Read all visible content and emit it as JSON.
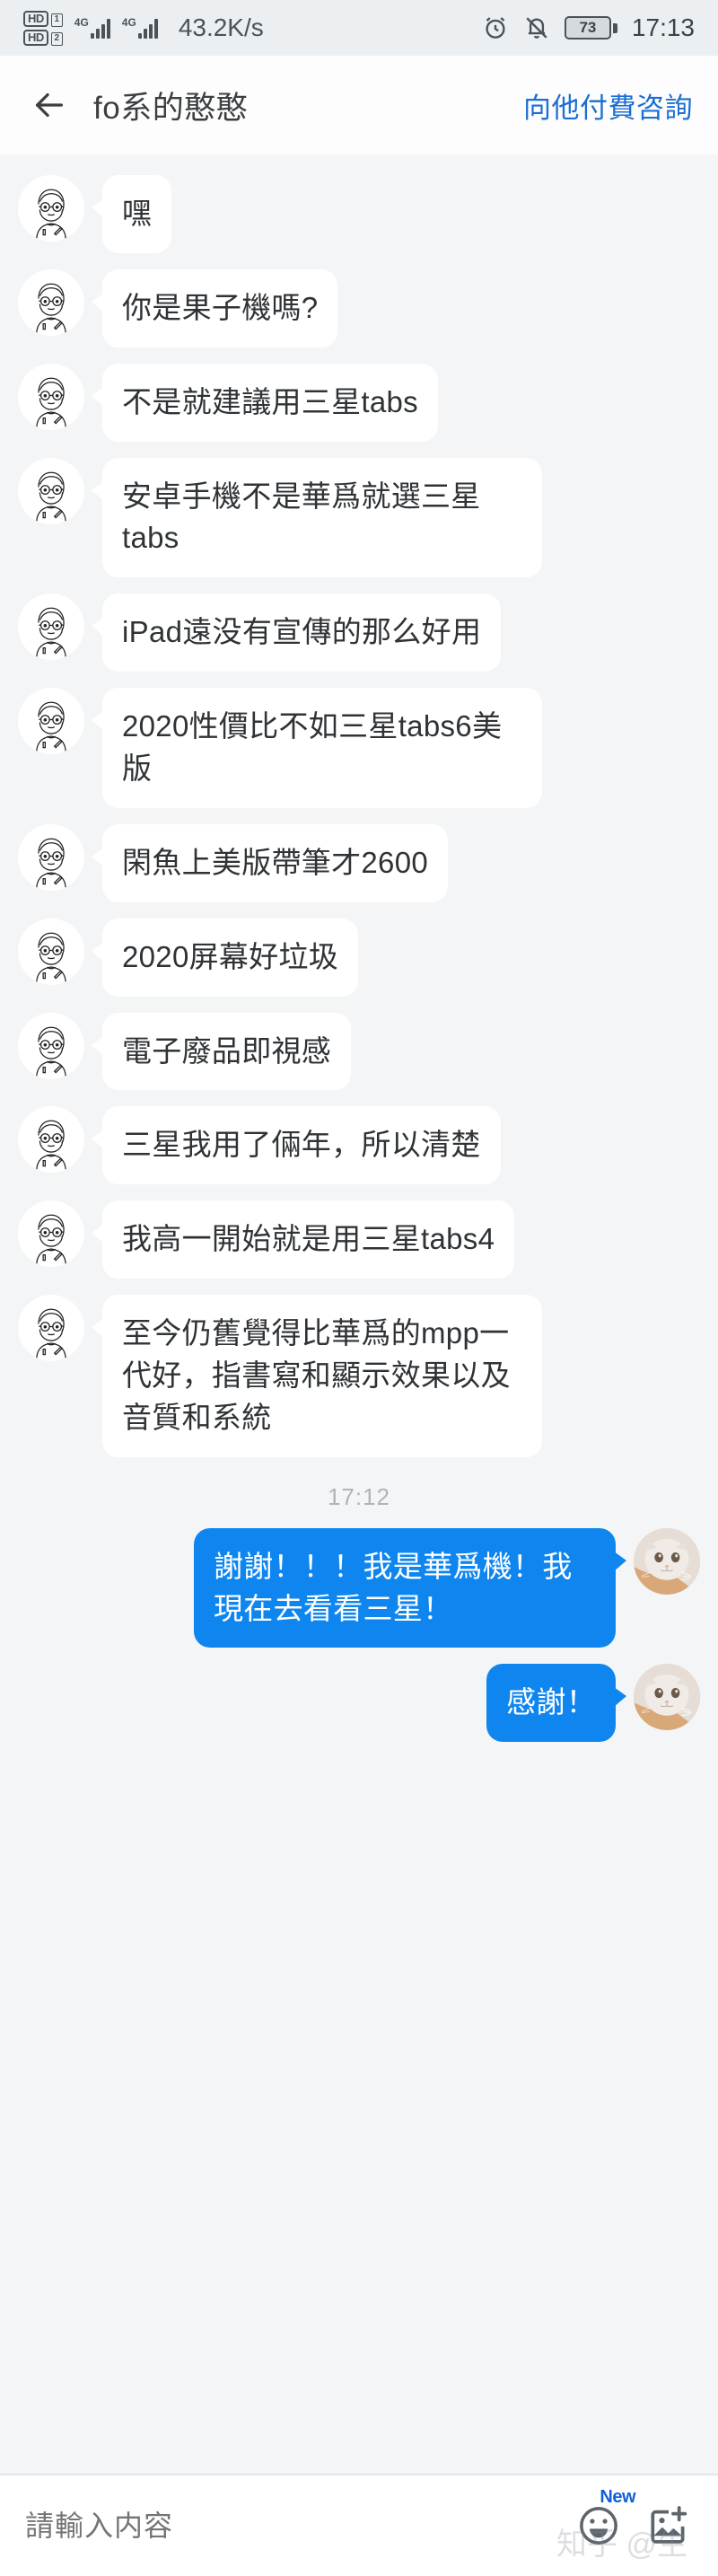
{
  "statusbar": {
    "hd_label_1": "HD",
    "hd_label_2": "HD",
    "sim1": "1",
    "sim2": "2",
    "network_1": "4G",
    "network_2": "4G",
    "net_speed": "43.2K/s",
    "battery_percent": "73",
    "time": "17:13",
    "alarm_icon": "alarm-clock-icon",
    "mute_icon": "bell-muted-icon"
  },
  "header": {
    "back_icon": "back-arrow-icon",
    "title": "fo系的憨憨",
    "paid_consult_label": "向他付費咨詢",
    "link_color": "#1b6fd2"
  },
  "chat": {
    "bubble_in_color": "#ffffff",
    "bubble_out_color": "#0f86ef",
    "background": "#f4f5f6",
    "messages": [
      {
        "side": "in",
        "text": "嘿",
        "avatar": "contact-avatar"
      },
      {
        "side": "in",
        "text": "你是果子機嗎?",
        "avatar": "contact-avatar"
      },
      {
        "side": "in",
        "text": "不是就建議用三星tabs",
        "avatar": "contact-avatar"
      },
      {
        "side": "in",
        "text": "安卓手機不是華爲就選三星tabs",
        "avatar": "contact-avatar"
      },
      {
        "side": "in",
        "text": "iPad遠没有宣傳的那么好用",
        "avatar": "contact-avatar"
      },
      {
        "side": "in",
        "text": "2020性價比不如三星tabs6美版",
        "avatar": "contact-avatar"
      },
      {
        "side": "in",
        "text": "閑魚上美版帶筆才2600",
        "avatar": "contact-avatar"
      },
      {
        "side": "in",
        "text": "2020屏幕好垃圾",
        "avatar": "contact-avatar"
      },
      {
        "side": "in",
        "text": "電子廢品即視感",
        "avatar": "contact-avatar"
      },
      {
        "side": "in",
        "text": "三星我用了倆年，所以清楚",
        "avatar": "contact-avatar"
      },
      {
        "side": "in",
        "text": "我高一開始就是用三星tabs4",
        "avatar": "contact-avatar"
      },
      {
        "side": "in",
        "text": "至今仍舊覺得比華爲的mpp一代好，指書寫和顯示效果以及音質和系統",
        "avatar": "contact-avatar"
      }
    ],
    "timestamp": "17:12",
    "outgoing": [
      {
        "side": "out",
        "text": "謝謝！！！我是華爲機！我現在去看看三星！",
        "avatar": "cat-avatar"
      },
      {
        "side": "out",
        "text": "感謝！",
        "avatar": "cat-avatar"
      }
    ]
  },
  "composer": {
    "placeholder": "請輸入内容",
    "emoji_icon": "emoji-smiley-icon",
    "emoji_new_badge": "New",
    "image_icon": "add-image-icon"
  },
  "watermark": {
    "text": "知乎 @生"
  }
}
